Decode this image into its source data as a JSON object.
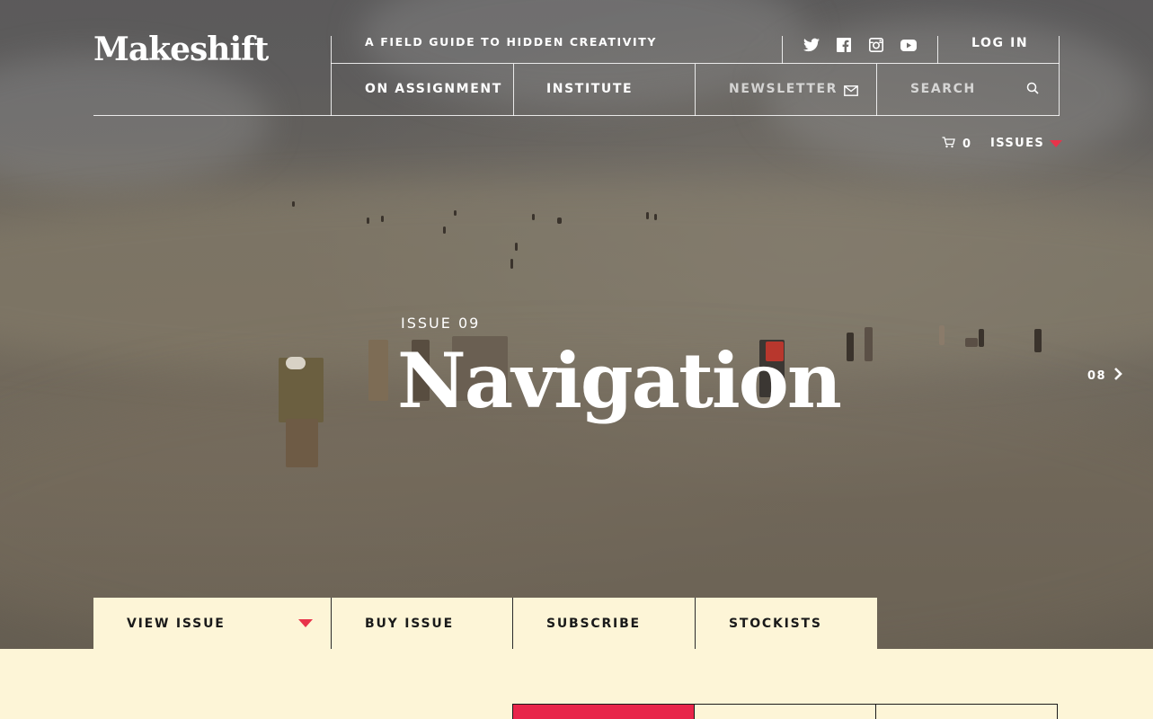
{
  "brand": {
    "logo": "Makeshift",
    "tagline": "A FIELD GUIDE TO HIDDEN CREATIVITY"
  },
  "header": {
    "social_icons": [
      "twitter-icon",
      "facebook-icon",
      "instagram-icon",
      "youtube-icon"
    ],
    "login_label": "LOG IN",
    "nav": [
      {
        "label": "ON ASSIGNMENT"
      },
      {
        "label": "INSTITUTE"
      }
    ],
    "newsletter_label": "NEWSLETTER",
    "newsletter_icon": "envelope-icon",
    "search_placeholder": "SEARCH",
    "search_icon": "search-icon"
  },
  "utility": {
    "cart_icon": "cart-icon",
    "cart_count": "0",
    "issues_label": "ISSUES",
    "accent_color": "#e8334a"
  },
  "hero": {
    "issue_number": "ISSUE 09",
    "issue_title": "Navigation",
    "prev_issue": "08",
    "prev_icon": "chevron-right-icon"
  },
  "actions": {
    "view_issue": "VIEW ISSUE",
    "buy_issue": "BUY ISSUE",
    "subscribe": "SUBSCRIBE",
    "stockists": "STOCKISTS"
  },
  "colors": {
    "cream": "#fdf5d7",
    "red": "#e8254a",
    "text_dark": "#1a1a1a"
  }
}
